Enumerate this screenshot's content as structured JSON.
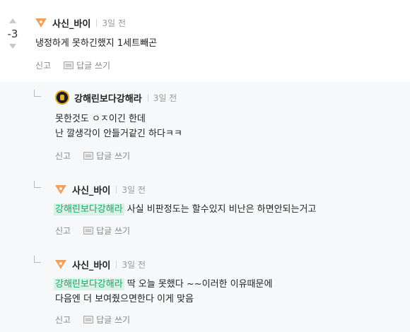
{
  "main_comment": {
    "score": "-3",
    "nickname": "사신_바이",
    "time": "3일 전",
    "body": "냉정하게 못하긴했지 1세트빼곤",
    "report_label": "신고",
    "reply_label": "답글 쓰기",
    "badge_icon": "orange-triangle-badge-icon"
  },
  "replies": [
    {
      "nickname": "강해린보다강해라",
      "time": "3일 전",
      "mention": "",
      "lines": [
        "못한것도 ㅇㅈ이긴 한데",
        "난 깔생각이 안들거같긴 하다ㅋㅋ"
      ],
      "report_label": "신고",
      "reply_label": "답글 쓰기",
      "badge_icon": "round-gold-badge-icon"
    },
    {
      "nickname": "사신_바이",
      "time": "3일 전",
      "mention": "강해린보다강해라",
      "lines": [
        "사실 비판정도는 할수있지 비난은 하면안되는거고"
      ],
      "report_label": "신고",
      "reply_label": "답글 쓰기",
      "badge_icon": "orange-triangle-badge-icon"
    },
    {
      "nickname": "사신_바이",
      "time": "3일 전",
      "mention": "강해린보다강해라",
      "lines": [
        "딱 오늘 못했다 ~~이러한 이유때문에",
        "다음엔 더 보여줬으면한다 이게 맞음"
      ],
      "report_label": "신고",
      "reply_label": "답글 쓰기",
      "badge_icon": "orange-triangle-badge-icon"
    }
  ],
  "colors": {
    "reply_background": "#f6f8f9",
    "mention_background": "#d8f2e4",
    "mention_text": "#17a86a",
    "badge_orange": "#f0a060"
  }
}
